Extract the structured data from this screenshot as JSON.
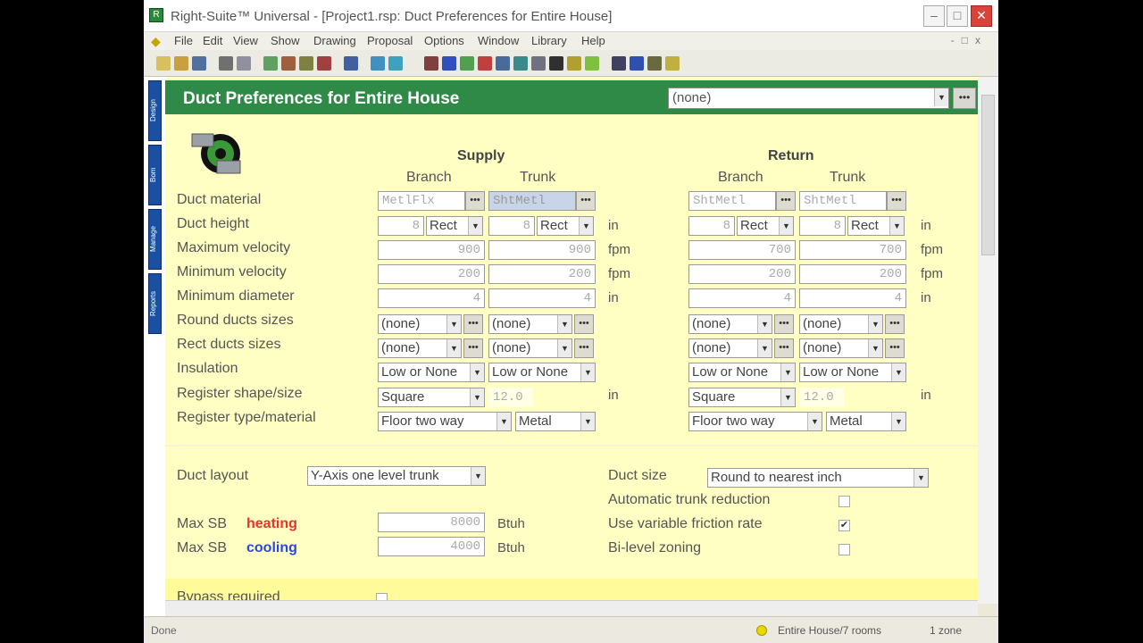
{
  "window": {
    "title": "Right-Suite™ Universal - [Project1.rsp: Duct Preferences for Entire House]"
  },
  "menu": [
    "File",
    "Edit",
    "View",
    "Show",
    "Drawing",
    "Proposal",
    "Options",
    "Window",
    "Library",
    "Help"
  ],
  "side_tabs": [
    "Design",
    "Bom",
    "Manage",
    "Reports"
  ],
  "header": {
    "title": "Duct Preferences for Entire House",
    "select_value": "(none)",
    "dots": "•••"
  },
  "groups": {
    "supply": "Supply",
    "return": "Return",
    "branch": "Branch",
    "trunk": "Trunk"
  },
  "row_labels": {
    "duct_material": "Duct material",
    "duct_height": "Duct height",
    "max_velocity": "Maximum velocity",
    "min_velocity": "Minimum velocity",
    "min_diameter": "Minimum diameter",
    "round_sizes": "Round ducts sizes",
    "rect_sizes": "Rect ducts sizes",
    "insulation": "Insulation",
    "register_shape": "Register shape/size",
    "register_type": "Register type/material"
  },
  "units": {
    "in": "in",
    "fpm": "fpm"
  },
  "supply_branch": {
    "material": "MetlFlx",
    "height": "8",
    "height_shape": "Rect",
    "max_velocity": "900",
    "min_velocity": "200",
    "min_diameter": "4",
    "round_sizes": "(none)",
    "rect_sizes": "(none)",
    "insulation": "Low or None",
    "register_shape": "Square",
    "register_type": "Floor two way"
  },
  "supply_trunk": {
    "material": "ShtMetl",
    "height": "8",
    "height_shape": "Rect",
    "max_velocity": "900",
    "min_velocity": "200",
    "min_diameter": "4",
    "round_sizes": "(none)",
    "rect_sizes": "(none)",
    "insulation": "Low or None",
    "register_size": "12.0",
    "register_material": "Metal"
  },
  "return_branch": {
    "material": "ShtMetl",
    "height": "8",
    "height_shape": "Rect",
    "max_velocity": "700",
    "min_velocity": "200",
    "min_diameter": "4",
    "round_sizes": "(none)",
    "rect_sizes": "(none)",
    "insulation": "Low or None",
    "register_shape": "Square",
    "register_type": "Floor two way"
  },
  "return_trunk": {
    "material": "ShtMetl",
    "height": "8",
    "height_shape": "Rect",
    "max_velocity": "700",
    "min_velocity": "200",
    "min_diameter": "4",
    "round_sizes": "(none)",
    "rect_sizes": "(none)",
    "insulation": "Low or None",
    "register_size": "12.0",
    "register_material": "Metal"
  },
  "layout": {
    "duct_layout_label": "Duct layout",
    "duct_layout_value": "Y-Axis one level trunk",
    "max_sb": "Max SB",
    "heating": "heating",
    "cooling": "cooling",
    "heating_value": "8000",
    "cooling_value": "4000",
    "btuh": "Btuh",
    "duct_size_label": "Duct size",
    "duct_size_value": "Round to nearest inch",
    "auto_trunk_label": "Automatic trunk reduction",
    "variable_friction_label": "Use variable friction rate",
    "bilevel_label": "Bi-level zoning",
    "check_mark": "✔",
    "bypass_label": "Bypass required"
  },
  "colors": {
    "header_green": "#2f8a48",
    "panel_yellow": "#ffffc4",
    "heating_red": "#e8342a",
    "cooling_blue": "#2a48e0"
  },
  "status": {
    "left": "Done",
    "zone": "Entire House/7 rooms",
    "right": "1 zone"
  }
}
